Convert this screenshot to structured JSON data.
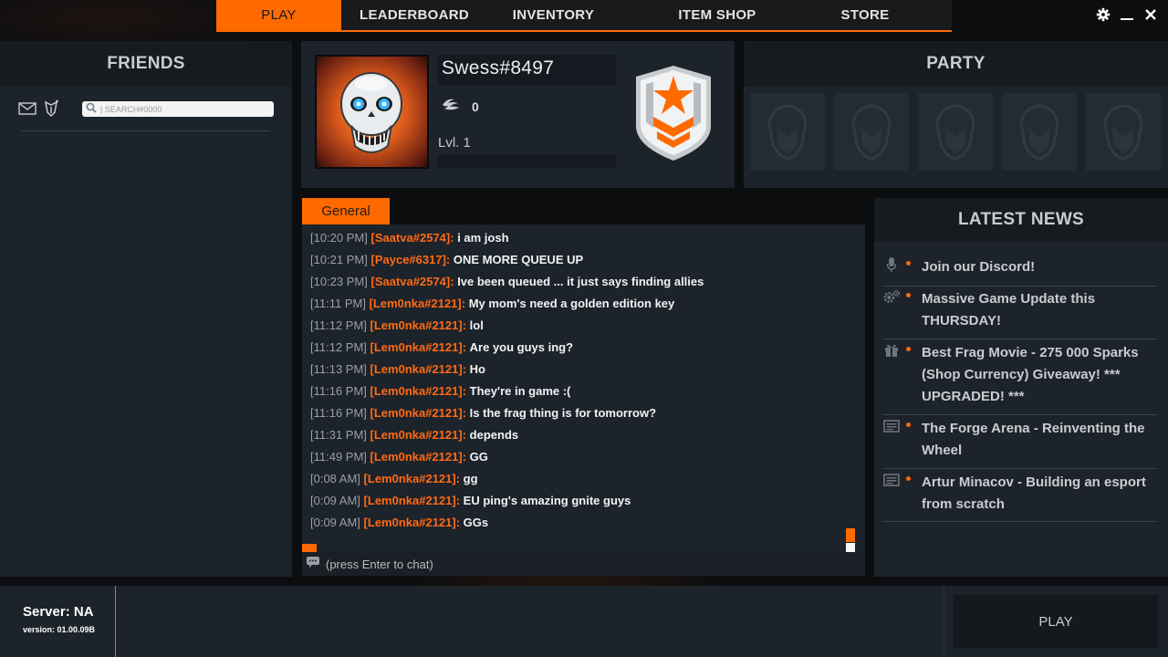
{
  "nav": {
    "tabs": [
      {
        "label": "PLAY"
      },
      {
        "label": "LEADERBOARD"
      },
      {
        "label": "INVENTORY"
      },
      {
        "label": "ITEM SHOP"
      },
      {
        "label": "STORE"
      }
    ],
    "active_tab": "PLAY"
  },
  "window_controls": {
    "icons": [
      "gear-icon",
      "minimize-icon",
      "close-icon"
    ]
  },
  "friends": {
    "title": "FRIENDS",
    "search_placeholder": "| SEARCH#0000",
    "tool_icons": [
      "mail-icon",
      "add-friend-icon"
    ]
  },
  "profile": {
    "username": "Swess#8497",
    "sparks": "0",
    "level": "Lvl. 1",
    "level_progress": 0
  },
  "party": {
    "title": "PARTY",
    "slots": 5
  },
  "chat": {
    "tab": "General",
    "input_placeholder": "(press Enter to chat)",
    "messages": [
      {
        "time": "[10:20 PM]",
        "user": "[Saatva#2574]:",
        "text": "i am josh"
      },
      {
        "time": "[10:21 PM]",
        "user": "[Payce#6317]:",
        "text": "ONE MORE QUEUE UP"
      },
      {
        "time": "[10:23 PM]",
        "user": "[Saatva#2574]:",
        "text": "Ive been queued ... it just says finding allies"
      },
      {
        "time": "[11:11 PM]",
        "user": "[Lem0nka#2121]:",
        "text": "My mom's need a golden edition key"
      },
      {
        "time": "[11:12 PM]",
        "user": "[Lem0nka#2121]:",
        "text": "lol"
      },
      {
        "time": "[11:12 PM]",
        "user": "[Lem0nka#2121]:",
        "text": "Are you guys ing?"
      },
      {
        "time": "[11:13 PM]",
        "user": "[Lem0nka#2121]:",
        "text": "Ho"
      },
      {
        "time": "[11:16 PM]",
        "user": "[Lem0nka#2121]:",
        "text": "They're in game :("
      },
      {
        "time": "[11:16 PM]",
        "user": "[Lem0nka#2121]:",
        "text": "Is the frag thing is for tomorrow?"
      },
      {
        "time": "[11:31 PM]",
        "user": "[Lem0nka#2121]:",
        "text": "depends"
      },
      {
        "time": "[11:49 PM]",
        "user": "[Lem0nka#2121]:",
        "text": "GG"
      },
      {
        "time": "[0:08 AM]",
        "user": "[Lem0nka#2121]:",
        "text": "gg"
      },
      {
        "time": "[0:09 AM]",
        "user": "[Lem0nka#2121]:",
        "text": "EU ping's amazing gnite guys"
      },
      {
        "time": "[0:09 AM]",
        "user": "[Lem0nka#2121]:",
        "text": "GGs"
      }
    ]
  },
  "news": {
    "title": "LATEST NEWS",
    "items": [
      {
        "icon": "microphone-icon",
        "lines": [
          "Join our Discord!"
        ]
      },
      {
        "icon": "gears-icon",
        "lines": [
          "Massive Game Update this",
          "THURSDAY!"
        ]
      },
      {
        "icon": "gift-icon",
        "lines": [
          "Best Frag Movie - 275 000 Sparks",
          "(Shop Currency) Giveaway! ***",
          "UPGRADED! ***"
        ]
      },
      {
        "icon": "article-icon",
        "lines": [
          "The Forge Arena - Reinventing the",
          "Wheel"
        ]
      },
      {
        "icon": "article-icon",
        "lines": [
          "Artur Minacov - Building an esport",
          "from scratch"
        ]
      }
    ]
  },
  "footer": {
    "server": "Server: NA",
    "version": "version: 01.00.09B",
    "play_label": "PLAY"
  },
  "colors": {
    "accent": "#ff6a00",
    "panel": "#1c232a",
    "background": "#0c0d0f"
  }
}
